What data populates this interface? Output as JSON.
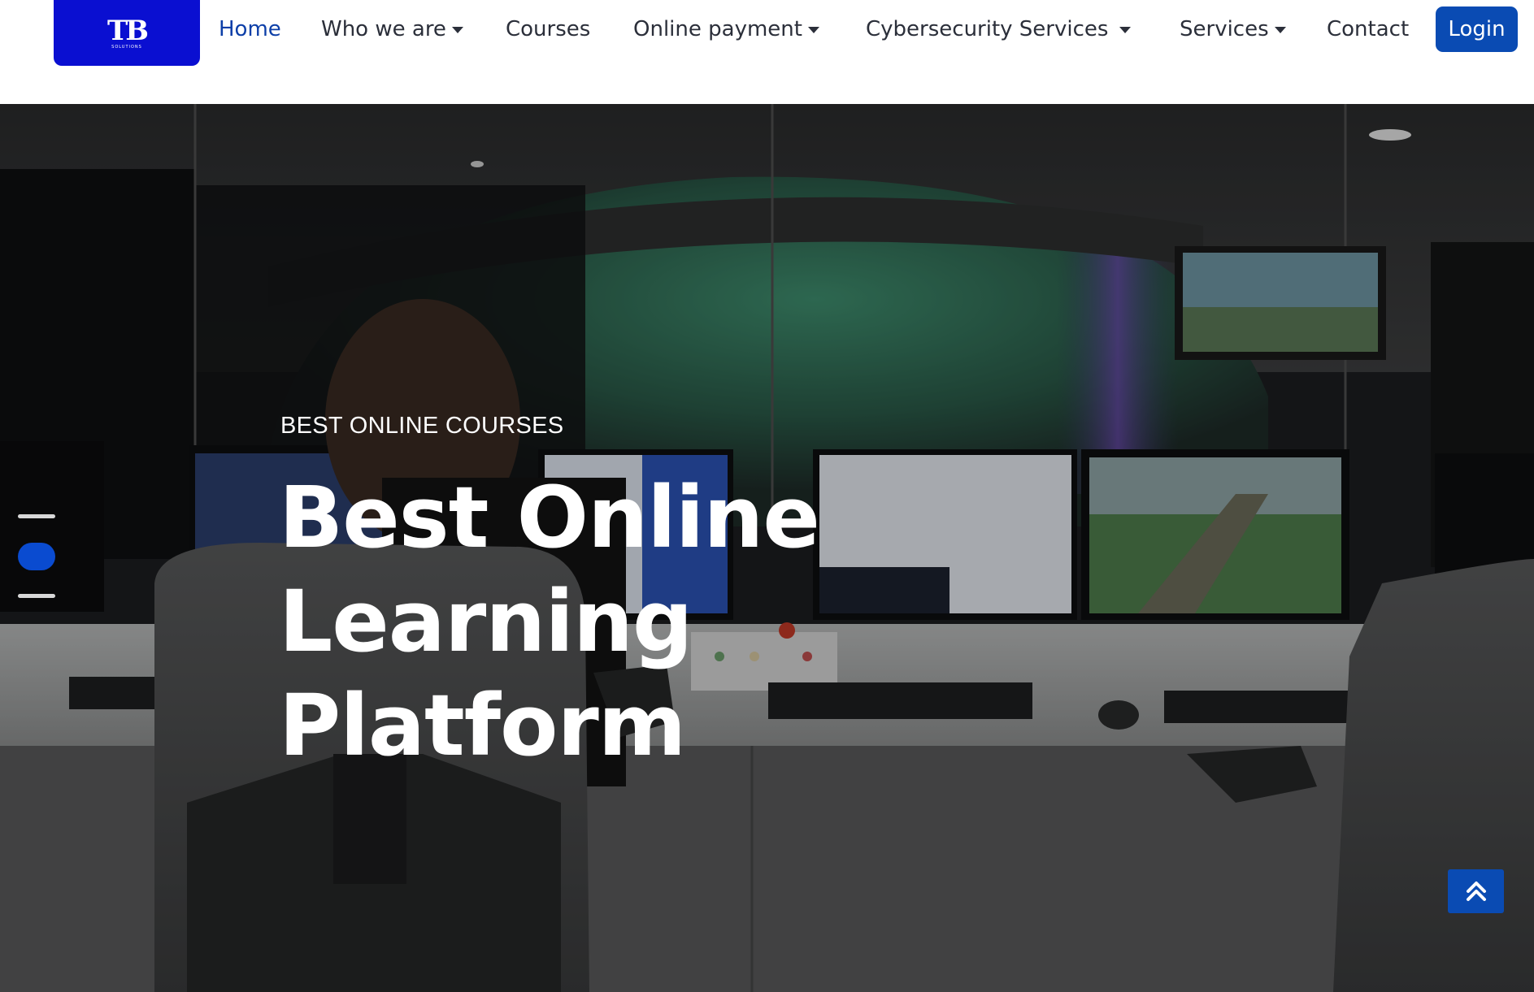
{
  "brand": {
    "logo_letters": "TB",
    "logo_sub": "SOLUTIONS",
    "logo_color": "#0a0fd1"
  },
  "nav": {
    "items": [
      {
        "label": "Home",
        "active": true,
        "dropdown": false
      },
      {
        "label": "Who we are",
        "active": false,
        "dropdown": true
      },
      {
        "label": "Courses",
        "active": false,
        "dropdown": false
      },
      {
        "label": "Online payment",
        "active": false,
        "dropdown": true
      },
      {
        "label": "Cybersecurity Services",
        "active": false,
        "dropdown": true
      },
      {
        "label": "Services",
        "active": false,
        "dropdown": true
      },
      {
        "label": "Contact",
        "active": false,
        "dropdown": false
      }
    ],
    "login_label": "Login",
    "active_color": "#0d3fa8",
    "accent_color": "#0a4bb3"
  },
  "hero": {
    "eyebrow": "BEST ONLINE COURSES",
    "title_line1": "Best Online Learning",
    "title_line2": "Platform",
    "carousel": {
      "slide_count": 3,
      "active_slide": 2
    }
  },
  "icons": {
    "back_to_top": "double-chevron-up-icon",
    "dropdown": "caret-down-icon"
  }
}
